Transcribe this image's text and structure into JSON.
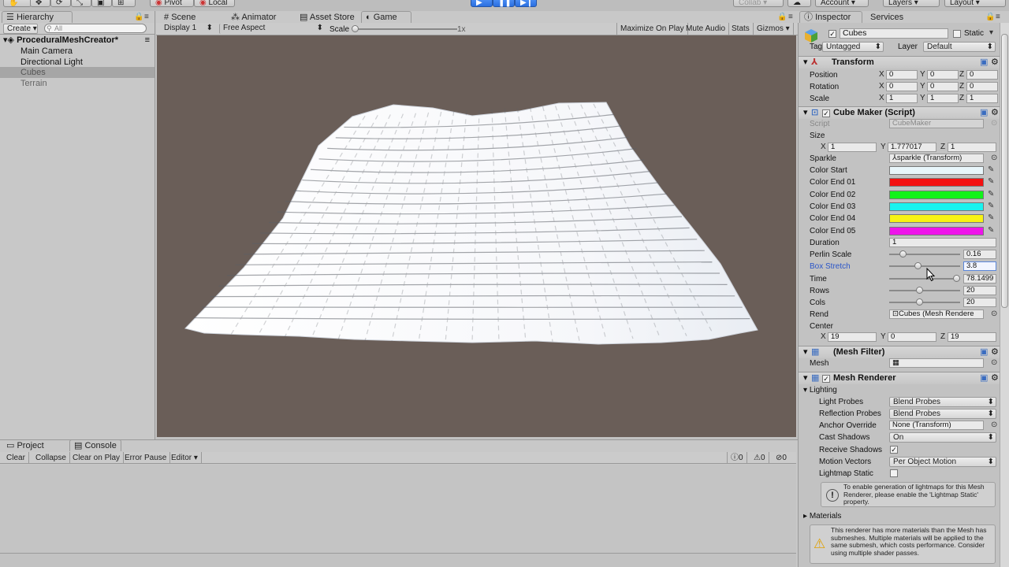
{
  "toolbar": {
    "pivot": "Pivot",
    "local": "Local",
    "collab": "Collab",
    "account": "Account",
    "layers": "Layers",
    "layout": "Layout"
  },
  "hierarchy": {
    "tab": "Hierarchy",
    "create": "Create",
    "search_placeholder": "All",
    "scene_name": "ProceduralMeshCreator*",
    "items": [
      "Main Camera",
      "Directional Light",
      "Cubes",
      "Terrain"
    ]
  },
  "center_tabs": [
    "Scene",
    "Animator",
    "Asset Store",
    "Game"
  ],
  "game_bar": {
    "display": "Display 1",
    "aspect": "Free Aspect",
    "scale_label": "Scale",
    "scale_value": "1x",
    "maximize": "Maximize On Play",
    "mute": "Mute Audio",
    "stats": "Stats",
    "gizmos": "Gizmos"
  },
  "console": {
    "tabs": [
      "Project",
      "Console"
    ],
    "buttons": [
      "Clear",
      "Collapse",
      "Clear on Play",
      "Error Pause",
      "Editor"
    ],
    "count_info": "0",
    "count_warn": "0",
    "count_error": "0"
  },
  "inspector": {
    "tabs": [
      "Inspector",
      "Services"
    ],
    "object_name": "Cubes",
    "static_label": "Static",
    "tag_label": "Tag",
    "tag_value": "Untagged",
    "layer_label": "Layer",
    "layer_value": "Default",
    "transform": {
      "title": "Transform",
      "rows": [
        {
          "label": "Position",
          "x": "0",
          "y": "0",
          "z": "0"
        },
        {
          "label": "Rotation",
          "x": "0",
          "y": "0",
          "z": "0"
        },
        {
          "label": "Scale",
          "x": "1",
          "y": "1",
          "z": "1"
        }
      ]
    },
    "cube_maker": {
      "title": "Cube Maker (Script)",
      "script_label": "Script",
      "script_value": "CubeMaker",
      "size_label": "Size",
      "size_x": "1",
      "size_y": "1.777017",
      "size_z": "1",
      "sparkle_label": "Sparkle",
      "sparkle_value": "sparkle (Transform)",
      "colors": [
        {
          "label": "Color Start",
          "color": "#e8f6fb"
        },
        {
          "label": "Color End 01",
          "color": "#f41010"
        },
        {
          "label": "Color End 02",
          "color": "#12f21a"
        },
        {
          "label": "Color End 03",
          "color": "#19f3ef"
        },
        {
          "label": "Color End 04",
          "color": "#f7f313"
        },
        {
          "label": "Color End 05",
          "color": "#ee14ea"
        }
      ],
      "duration_label": "Duration",
      "duration_value": "1",
      "sliders": [
        {
          "label": "Perlin Scale",
          "value": "0.16",
          "fraction": 0.16
        },
        {
          "label": "Box Stretch",
          "value": "3.8",
          "fraction": 0.38
        },
        {
          "label": "Time",
          "value": "78.1499",
          "fraction": 0.97
        },
        {
          "label": "Rows",
          "value": "20",
          "fraction": 0.4
        },
        {
          "label": "Cols",
          "value": "20",
          "fraction": 0.4
        }
      ],
      "rend_label": "Rend",
      "rend_value": "Cubes (Mesh Rendere",
      "center_label": "Center",
      "center_x": "19",
      "center_y": "0",
      "center_z": "19"
    },
    "mesh_filter": {
      "title": "(Mesh Filter)",
      "mesh_label": "Mesh"
    },
    "mesh_renderer": {
      "title": "Mesh Renderer",
      "lighting": "Lighting",
      "light_probes_label": "Light Probes",
      "light_probes_value": "Blend Probes",
      "reflection_label": "Reflection Probes",
      "reflection_value": "Blend Probes",
      "anchor_label": "Anchor Override",
      "anchor_value": "None (Transform)",
      "cast_label": "Cast Shadows",
      "cast_value": "On",
      "receive_label": "Receive Shadows",
      "motion_label": "Motion Vectors",
      "motion_value": "Per Object Motion",
      "lightmap_label": "Lightmap Static",
      "lightmap_info": "To enable generation of lightmaps for this Mesh Renderer, please enable the 'Lightmap Static' property.",
      "materials": "Materials",
      "materials_warning": "This renderer has more materials than the Mesh has submeshes. Multiple materials will be applied to the same submesh, which costs performance. Consider using multiple shader passes."
    }
  },
  "scene": {
    "background": "#6a5e58",
    "mesh_color": "#f5f6f8"
  }
}
